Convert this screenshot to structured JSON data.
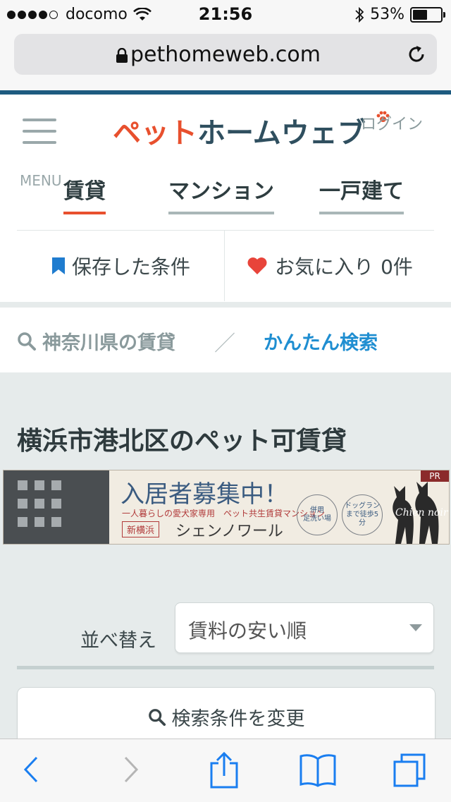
{
  "status_bar": {
    "carrier": "docomo",
    "time": "21:56",
    "battery": "53%",
    "battery_level": 0.53,
    "signal_bars_filled": 4,
    "signal_bars_total": 5
  },
  "browser": {
    "url": "pethomeweb.com"
  },
  "header": {
    "menu_label": "MENU",
    "logo_part1": "ペット",
    "logo_part2": "ホームウェブ",
    "login_label": "ログイン",
    "tabs": [
      {
        "label": "賃貸",
        "active": true
      },
      {
        "label": "マンション",
        "active": false
      },
      {
        "label": "一戸建て",
        "active": false
      }
    ],
    "saved_label": "保存した条件",
    "favorites_label": "お気に入り",
    "favorites_count": "0件"
  },
  "breadcrumb": {
    "region": "神奈川県の賃貸",
    "separator": "／",
    "current": "かんたん検索"
  },
  "page_title": "横浜市港北区のペット可賃貸",
  "banner": {
    "title": "入居者募集中！",
    "subtitle": "一人暮らしの愛犬家専用　ペット共生賃貸マンション",
    "area": "新横浜",
    "name": "シェンノワール",
    "feature1_line1": "併用",
    "feature1_line2": "足洗い場",
    "feature2_line1": "ドッグラン",
    "feature2_line2": "まで徒歩5分",
    "pr": "PR",
    "brand": "Chien noir"
  },
  "sort": {
    "label": "並べ替え",
    "selected": "賃料の安い順"
  },
  "search_button_label": "検索条件を変更",
  "colors": {
    "accent_red": "#e8502e",
    "link_blue": "#1f8ed1",
    "navy": "#1e5b80",
    "ios_blue": "#1a7ef0"
  }
}
